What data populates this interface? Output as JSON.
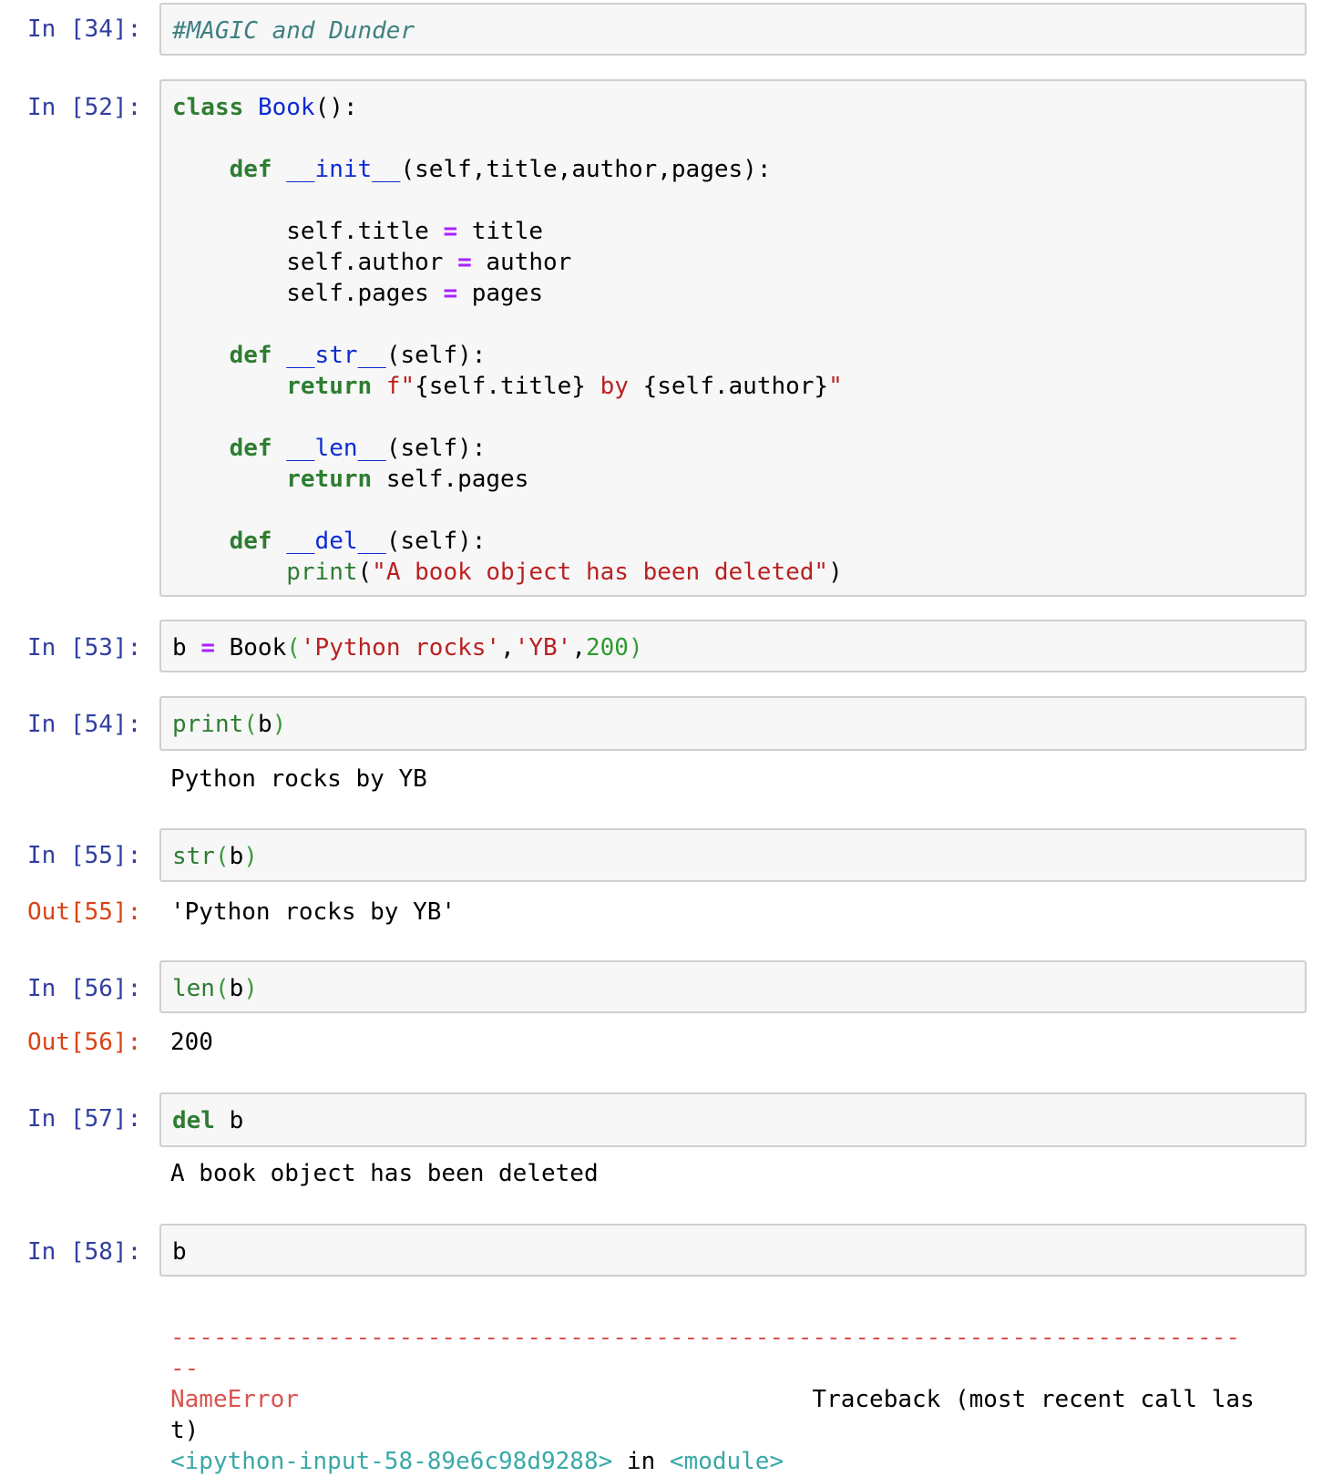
{
  "cells": [
    {
      "prompt": "In [34]:",
      "code_comment": "#MAGIC and Dunder"
    },
    {
      "prompt": "In [52]:",
      "class_kw": "class",
      "class_name": "Book",
      "class_tail": "():",
      "def_kw": "def",
      "init_name": "__init__",
      "init_args": "(self,title,author,pages):",
      "assign": [
        {
          "lhs": "self.title",
          "eq": "=",
          "rhs": "title"
        },
        {
          "lhs": "self.author",
          "eq": "=",
          "rhs": "author"
        },
        {
          "lhs": "self.pages",
          "eq": "=",
          "rhs": "pages"
        }
      ],
      "str_name": "__str__",
      "self_args": "(self):",
      "return_kw": "return",
      "fstr_prefix": "f\"",
      "fstr_a": "{self.title}",
      "fstr_mid": " by ",
      "fstr_b": "{self.author}",
      "fstr_end": "\"",
      "len_name": "__len__",
      "len_return": "self.pages",
      "del_name": "__del__",
      "print_fn": "print",
      "print_open": "(",
      "print_str": "\"A book object has been deleted\"",
      "print_close": ")"
    },
    {
      "prompt": "In [53]:",
      "var": "b",
      "eq": "=",
      "call": "Book",
      "open": "(",
      "arg1": "'Python rocks'",
      "comma": ",",
      "arg2": "'YB'",
      "comma2": ",",
      "arg3": "200",
      "close": ")"
    },
    {
      "prompt": "In [54]:",
      "fn": "print",
      "open": "(",
      "arg": "b",
      "close": ")",
      "stdout": "Python rocks by YB"
    },
    {
      "prompt": "In [55]:",
      "fn": "str",
      "open": "(",
      "arg": "b",
      "close": ")",
      "out_prompt": "Out[55]:",
      "out": "'Python rocks by YB'"
    },
    {
      "prompt": "In [56]:",
      "fn": "len",
      "open": "(",
      "arg": "b",
      "close": ")",
      "out_prompt": "Out[56]:",
      "out": "200"
    },
    {
      "prompt": "In [57]:",
      "kw": "del",
      "arg": "b",
      "stdout": "A book object has been deleted"
    },
    {
      "prompt": "In [58]:",
      "code": "b",
      "tb_dashes1": "---------------------------------------------------------------------------",
      "tb_dashes2": "--",
      "tb_error": "NameError",
      "tb_header": "Traceback (most recent call las",
      "tb_header2": "t)",
      "tb_input": "<ipython-input-58-89e6c98d9288>",
      "tb_in": " in ",
      "tb_module": "<module>"
    }
  ]
}
